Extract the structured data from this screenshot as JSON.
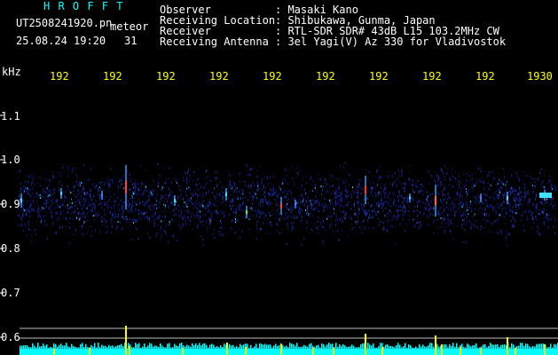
{
  "header": {
    "brand": "H R O F F T",
    "filename": "UT2508241920.pn",
    "tag": "meteor",
    "datetime": "25.08.24 19:20",
    "minute": "31",
    "observer_label": "Observer",
    "observer_value": ": Masaki Kano",
    "location_label": "Receiving Location",
    "location_value": ": Shibukawa, Gunma, Japan",
    "receiver_label": "Receiver",
    "receiver_value": ": RTL-SDR SDR# 43dB L15 103.2MHz CW",
    "antenna_label": "Receiving Antenna",
    "antenna_value": ": 3el Yagi(V) Az 330 for Vladivostok"
  },
  "axis": {
    "unit": "kHz",
    "y_ticks": [
      "1.1",
      "1.0",
      "0.9",
      "0.8",
      "0.7",
      "0.6"
    ],
    "x_ticks": [
      "192",
      "192",
      "192",
      "192",
      "192",
      "192",
      "192",
      "192",
      "192",
      "1930"
    ]
  },
  "colors": {
    "background": "#000000",
    "text": "#ffffff",
    "time_labels": "#ffff00",
    "band": "#1a2aa8",
    "baseline": "#00ffff",
    "meteor_peak": "#ffff00"
  }
}
